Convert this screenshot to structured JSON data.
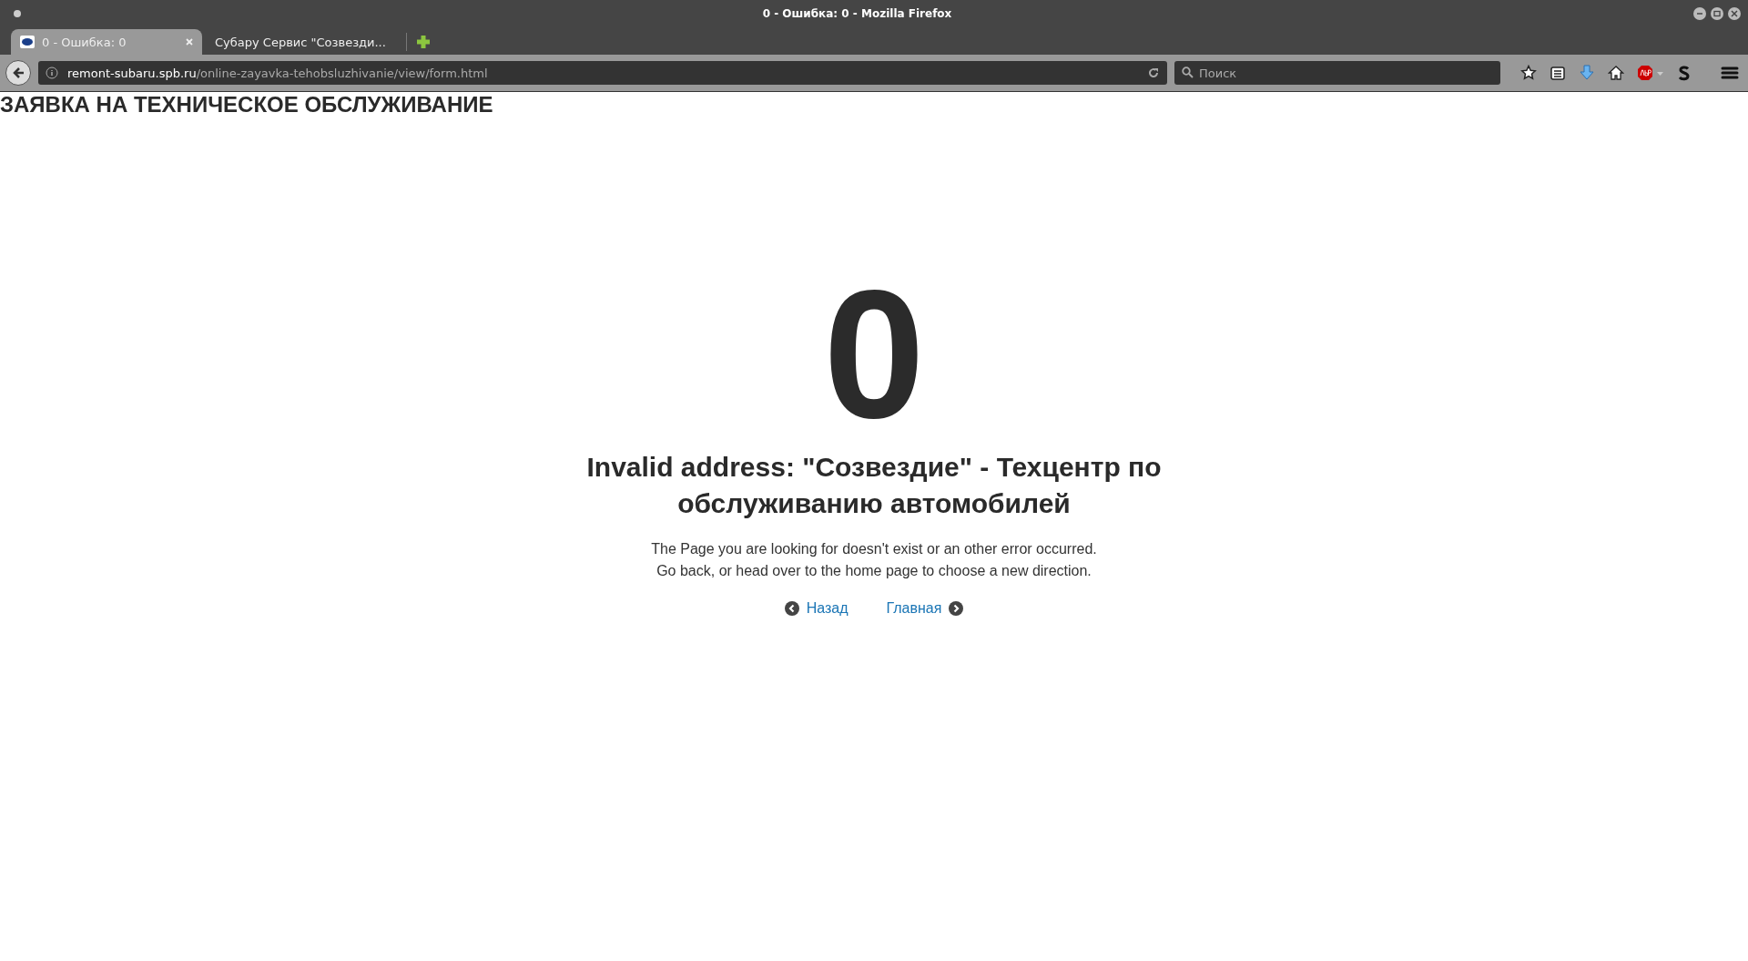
{
  "window": {
    "title": "0 - Ошибка: 0 - Mozilla Firefox"
  },
  "tabs": [
    {
      "label": "0 - Ошибка: 0",
      "selected": true
    },
    {
      "label": "Субару Сервис \"Созвезди...",
      "selected": false
    }
  ],
  "address_bar": {
    "host": "remont-subaru.spb.ru",
    "path": "/online-zayavka-tehobsluzhivanie/view/form.html"
  },
  "search": {
    "placeholder": "Поиск"
  },
  "page": {
    "heading": "ЗАЯВКА НА ТЕХНИЧЕСКОЕ ОБСЛУЖИВАНИЕ",
    "error_code": "0",
    "title": "Invalid address: \"Созвездие\" - Техцентр по обслуживанию автомобилей",
    "message": [
      "The Page you are looking for doesn't exist or an other error occurred.",
      "Go back, or head over to the home page to choose a new direction."
    ],
    "links": [
      {
        "label": "Назад",
        "kind": "back"
      },
      {
        "label": "Главная",
        "kind": "home"
      }
    ]
  }
}
